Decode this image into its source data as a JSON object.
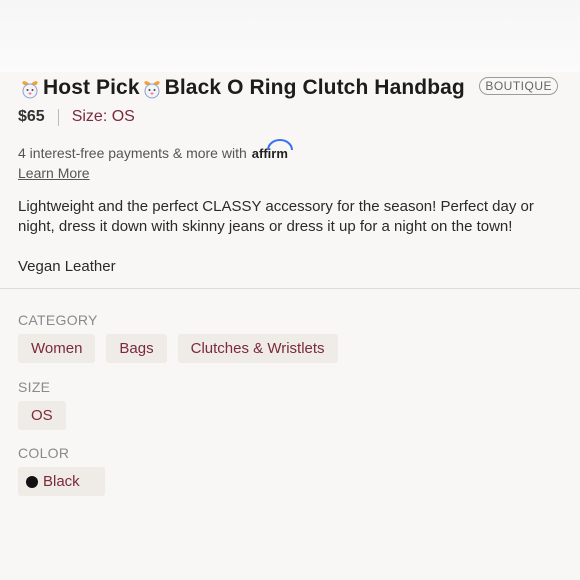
{
  "listing": {
    "emoji_icon": "gift-bunny-emoji-icon",
    "title_part1": "Host Pick",
    "title_part2": "Black O Ring Clutch Handbag",
    "badge": "BOUTIQUE",
    "price": "$65",
    "size_label": "Size: OS"
  },
  "payment": {
    "text": "4 interest-free payments & more with",
    "provider": "affirm",
    "learn_more": "Learn More"
  },
  "description": {
    "line1": "Lightweight and the perfect CLASSY accessory for the season! Perfect day or night, dress it down with skinny jeans or dress it up for a night on the town!",
    "line2": "Vegan Leather"
  },
  "category": {
    "label": "CATEGORY",
    "chips": [
      "Women",
      "Bags",
      "Clutches & Wristlets"
    ]
  },
  "size": {
    "label": "SIZE",
    "chips": [
      "OS"
    ]
  },
  "color": {
    "label": "COLOR",
    "chips": [
      "Black"
    ],
    "swatch": "#111111"
  },
  "colors": {
    "accent": "#7a2a3a",
    "chip_bg": "#efebe7",
    "background": "#f8f7f5"
  }
}
